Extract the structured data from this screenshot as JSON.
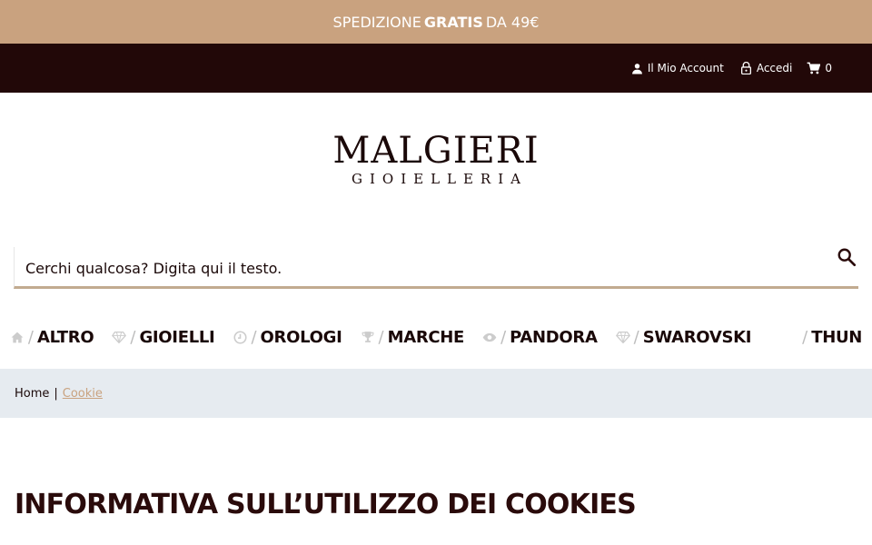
{
  "promo": {
    "prefix": "SPEDIZIONE",
    "bold": "GRATIS",
    "suffix": "DA 49€"
  },
  "topbar": {
    "account_label": "Il Mio Account",
    "login_label": "Accedi",
    "cart_count": "0"
  },
  "logo": {
    "main": "MALGIERI",
    "sub": "GIOIELLERIA"
  },
  "search": {
    "placeholder": "Cerchi qualcosa? Digita qui il testo."
  },
  "nav": {
    "items": [
      {
        "label": "ALTRO",
        "icon": "home-icon"
      },
      {
        "label": "GIOIELLI",
        "icon": "diamond-icon"
      },
      {
        "label": "OROLOGI",
        "icon": "clock-icon"
      },
      {
        "label": "MARCHE",
        "icon": "trophy-icon"
      },
      {
        "label": "PANDORA",
        "icon": "eye-icon"
      },
      {
        "label": "SWAROVSKI",
        "icon": "diamond-icon"
      },
      {
        "label": "THUN",
        "icon": ""
      }
    ],
    "separator": "/"
  },
  "breadcrumb": {
    "home": "Home",
    "separator": "|",
    "current": "Cookie"
  },
  "content": {
    "title": "INFORMATIVA SULL’UTILIZZO DEI COOKIES"
  },
  "colors": {
    "accent": "#c9a27f",
    "topbar": "#220808",
    "text": "#2a0b0b",
    "breadcrumb_bg": "#e6ebf0"
  }
}
